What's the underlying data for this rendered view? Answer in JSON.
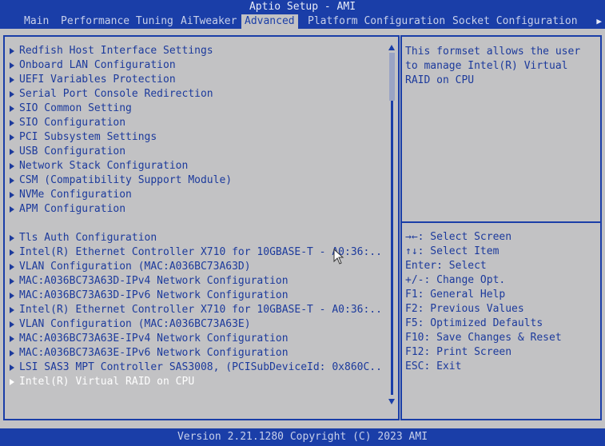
{
  "header": {
    "title": "Aptio Setup - AMI",
    "tabs": [
      "Main",
      "Performance Tuning",
      "AiTweaker",
      "Advanced",
      "Platform Configuration",
      "Socket Configuration"
    ],
    "active_tab": "Advanced",
    "more_icon": "right-arrow-icon"
  },
  "menu": {
    "group1": [
      "Redfish Host Interface Settings",
      "Onboard LAN Configuration",
      "UEFI Variables Protection",
      "Serial Port Console Redirection",
      "SIO Common Setting",
      "SIO Configuration",
      "PCI Subsystem Settings",
      "USB Configuration",
      "Network Stack Configuration",
      "CSM (Compatibility Support Module)",
      "NVMe Configuration",
      "APM Configuration"
    ],
    "group2": [
      "Tls Auth Configuration",
      "Intel(R) Ethernet Controller X710 for 10GBASE-T - A0:36:...",
      "VLAN Configuration (MAC:A036BC73A63D)",
      "MAC:A036BC73A63D-IPv4 Network Configuration",
      "MAC:A036BC73A63D-IPv6 Network Configuration",
      "Intel(R) Ethernet Controller X710 for 10GBASE-T - A0:36:...",
      "VLAN Configuration (MAC:A036BC73A63E)",
      "MAC:A036BC73A63E-IPv4 Network Configuration",
      "MAC:A036BC73A63E-IPv6 Network Configuration",
      "LSI SAS3 MPT Controller SAS3008, (PCISubDeviceId: 0x860C...",
      "Intel(R) Virtual RAID on CPU"
    ],
    "selected": "Intel(R) Virtual RAID on CPU"
  },
  "help": {
    "text": "This formset allows the user\nto manage Intel(R) Virtual\nRAID on CPU"
  },
  "keys": [
    "→←: Select Screen",
    "↑↓: Select Item",
    "Enter: Select",
    "+/-: Change Opt.",
    "F1: General Help",
    "F2: Previous Values",
    "F5: Optimized Defaults",
    "F10: Save Changes & Reset",
    "F12: Print Screen",
    "ESC: Exit"
  ],
  "footer": {
    "version": "Version 2.21.1280 Copyright (C) 2023 AMI"
  },
  "colors": {
    "accent": "#1a3ea8",
    "background": "#c2c2c4",
    "text": "#1c3a9c",
    "selected_text": "#ffffff"
  }
}
